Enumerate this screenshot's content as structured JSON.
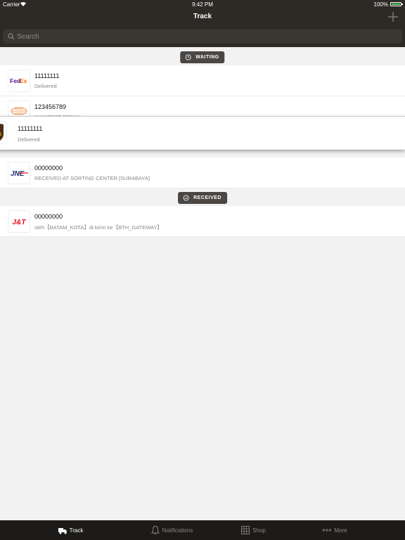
{
  "status_bar": {
    "carrier": "Carrier",
    "time": "9:42 PM",
    "battery": "100%"
  },
  "nav": {
    "title": "Track"
  },
  "search": {
    "placeholder": "Search"
  },
  "sections": {
    "waiting": {
      "label": "WAITING"
    },
    "received": {
      "label": "RECEIVED"
    }
  },
  "rows": [
    {
      "courier": "FedEx",
      "tracking": "11111111",
      "status": "Delivered"
    },
    {
      "courier": "Pos",
      "tracking": "123456789",
      "status": "MANIFEST SERAH"
    },
    {
      "courier": "UPS",
      "tracking": "11111111",
      "status": "Delivered"
    },
    {
      "courier": "JNE",
      "tracking": "00000000",
      "status": "RECEIVED AT SORTING CENTER [SURABAYA]"
    },
    {
      "courier": "J&T",
      "tracking": "00000000",
      "status": "oleh【BATAM_KOTA】di kirim ke【BTH_GATEWAY】"
    }
  ],
  "tabs": [
    {
      "label": "Track",
      "icon": "truck-icon",
      "active": true
    },
    {
      "label": "Notifications",
      "icon": "bell-icon",
      "active": false
    },
    {
      "label": "Shop",
      "icon": "shop-icon",
      "active": false
    },
    {
      "label": "More",
      "icon": "more-icon",
      "active": false
    }
  ],
  "colors": {
    "nav": "#2d2a26",
    "tab_bar": "#1c1b19",
    "badge": "#4a4744",
    "battery": "#4cd964"
  }
}
